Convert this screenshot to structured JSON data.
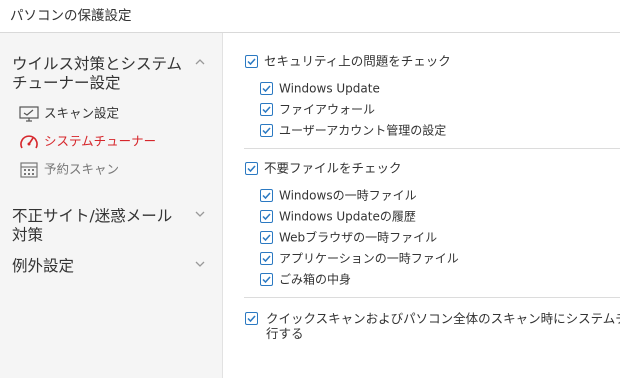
{
  "window": {
    "title": "パソコンの保護設定"
  },
  "sidebar": {
    "sections": [
      {
        "label_line1": "ウイルス対策とシステム",
        "label_line2": "チューナー設定",
        "chevron": "chevron-up-icon"
      },
      {
        "label_line1": "不正サイト/迷惑メール",
        "label_line2": "対策",
        "chevron": "chevron-down-icon"
      },
      {
        "label_line1": "例外設定",
        "label_line2": "",
        "chevron": "chevron-down-icon"
      }
    ],
    "items": [
      {
        "label": "スキャン設定",
        "icon": "monitor-scan-icon",
        "state": "normal"
      },
      {
        "label": "システムチューナー",
        "icon": "gauge-icon",
        "state": "active"
      },
      {
        "label": "予約スキャン",
        "icon": "calendar-icon",
        "state": "disabled"
      }
    ]
  },
  "main": {
    "security_check": {
      "label": "セキュリティ上の問題をチェック",
      "checked": true,
      "options": [
        {
          "label": "Windows Update",
          "checked": true
        },
        {
          "label": "ファイアウォール",
          "checked": true
        },
        {
          "label": "ユーザーアカウント管理の設定",
          "checked": true
        }
      ]
    },
    "junk_check": {
      "label": "不要ファイルをチェック",
      "checked": true,
      "options": [
        {
          "label": "Windowsの一時ファイル",
          "checked": true
        },
        {
          "label": "Windows Updateの履歴",
          "checked": true
        },
        {
          "label": "Webブラウザの一時ファイル",
          "checked": true
        },
        {
          "label": "アプリケーションの一時ファイル",
          "checked": true
        },
        {
          "label": "ごみ箱の中身",
          "checked": true
        }
      ]
    },
    "quick_scan": {
      "line1": "クイックスキャンおよびパソコン全体のスキャン時にシステムチュ",
      "line2": "行する",
      "checked": true
    }
  },
  "colors": {
    "accent": "#2b79c2",
    "active": "#d6262b",
    "sidebar_bg": "#f5f5f5"
  }
}
